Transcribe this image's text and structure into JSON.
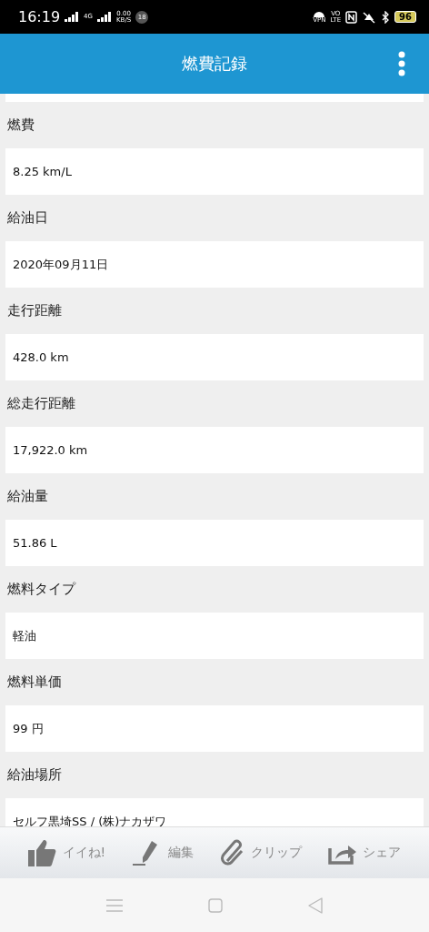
{
  "status_bar": {
    "time": "16:19",
    "network_type": "4G",
    "network_speed": "0.00",
    "speed_unit": "KB/S",
    "notification_count": "18",
    "volte": "VO",
    "volte_sub": "LTE",
    "vpn": "VPN",
    "battery": "96"
  },
  "app_bar": {
    "title": "燃費記録"
  },
  "fields": [
    {
      "label": "燃費",
      "value": "8.25 km/L"
    },
    {
      "label": "給油日",
      "value": "2020年09月11日"
    },
    {
      "label": "走行距離",
      "value": "428.0 km"
    },
    {
      "label": "総走行距離",
      "value": "17,922.0 km"
    },
    {
      "label": "給油量",
      "value": "51.86 L"
    },
    {
      "label": "燃料タイプ",
      "value": "軽油"
    },
    {
      "label": "燃料単価",
      "value": "99 円"
    },
    {
      "label": "給油場所",
      "value": "セルフ黒埼SS / (株)ナカザワ"
    }
  ],
  "toolbar": [
    {
      "kind": "like",
      "label": "イイね!"
    },
    {
      "kind": "edit",
      "label": "編集"
    },
    {
      "kind": "clip",
      "label": "クリップ"
    },
    {
      "kind": "share",
      "label": "シェア"
    }
  ]
}
